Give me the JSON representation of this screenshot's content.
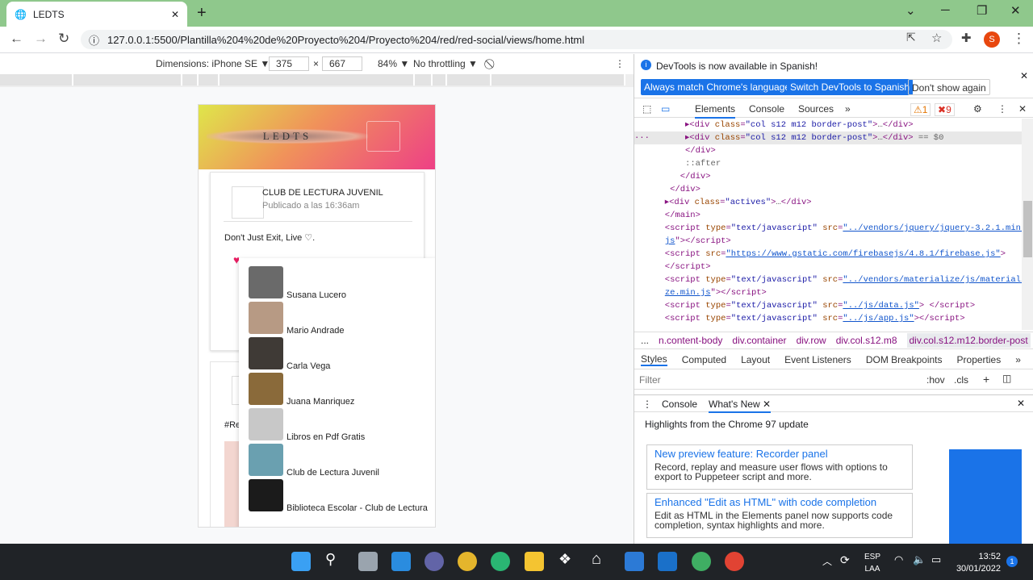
{
  "browser": {
    "tab_title": "LEDTS",
    "url": "127.0.0.1:5500/Plantilla%204%20de%20Proyecto%204/Proyecto%204/red/red-social/views/home.html",
    "profile_initial": "S"
  },
  "device_toolbar": {
    "dimensions_label": "Dimensions: iPhone SE ▼",
    "width": "375",
    "x_sep": "×",
    "height": "667",
    "zoom": "84% ▼",
    "throttling": "No throttling ▼"
  },
  "page": {
    "logo": "LEDTS",
    "post": {
      "author": "CLUB DE LECTURA JUVENIL",
      "date": "Publicado a las 16:36am",
      "text": "Don't Just Exit, Live ♡."
    },
    "post2_hashtag": "#Re",
    "dropdown": [
      {
        "name": "Susana Lucero",
        "color": "#6a6a6a"
      },
      {
        "name": "Mario Andrade",
        "color": "#b79a84"
      },
      {
        "name": "Carla Vega",
        "color": "#3f3a36"
      },
      {
        "name": "Juana Manriquez",
        "color": "#8a6a3a"
      },
      {
        "name": "Libros en Pdf Gratis",
        "color": "#c8c8c8"
      },
      {
        "name": "Club de Lectura Juvenil",
        "color": "#6aa0b0"
      },
      {
        "name": "Biblioteca Escolar - Club de Lectura",
        "color": "#1b1b1b"
      }
    ]
  },
  "devtools": {
    "info_text": "DevTools is now available in Spanish!",
    "btn_match": "Always match Chrome's language",
    "btn_switch": "Switch DevTools to Spanish",
    "btn_dont": "Don't show again",
    "tabs": [
      "Elements",
      "Console",
      "Sources",
      "»"
    ],
    "warn_count": "1",
    "err_count": "9",
    "breadcrumbs": [
      "...",
      "n.content-body",
      "div.container",
      "div.row",
      "div.col.s12.m8",
      "div.col.s12.m12.border-post",
      "..."
    ],
    "styles_tabs": [
      "Styles",
      "Computed",
      "Layout",
      "Event Listeners",
      "DOM Breakpoints",
      "Properties",
      "»"
    ],
    "filter_placeholder": "Filter",
    "hov": ":hov",
    "cls": ".cls",
    "drawer_tabs": [
      "Console",
      "What's New"
    ],
    "highlights": "Highlights from the Chrome 97 update",
    "news": [
      {
        "title": "New preview feature: Recorder panel",
        "body": "Record, replay and measure user flows with options to export to Puppeteer script and more."
      },
      {
        "title": "Enhanced \"Edit as HTML\" with code completion",
        "body": "Edit as HTML in the Elements panel now supports code completion, syntax highlights and more."
      }
    ]
  },
  "taskbar": {
    "lang1": "ESP",
    "lang2": "LAA",
    "time": "13:52",
    "date": "30/01/2022",
    "notif": "1"
  }
}
